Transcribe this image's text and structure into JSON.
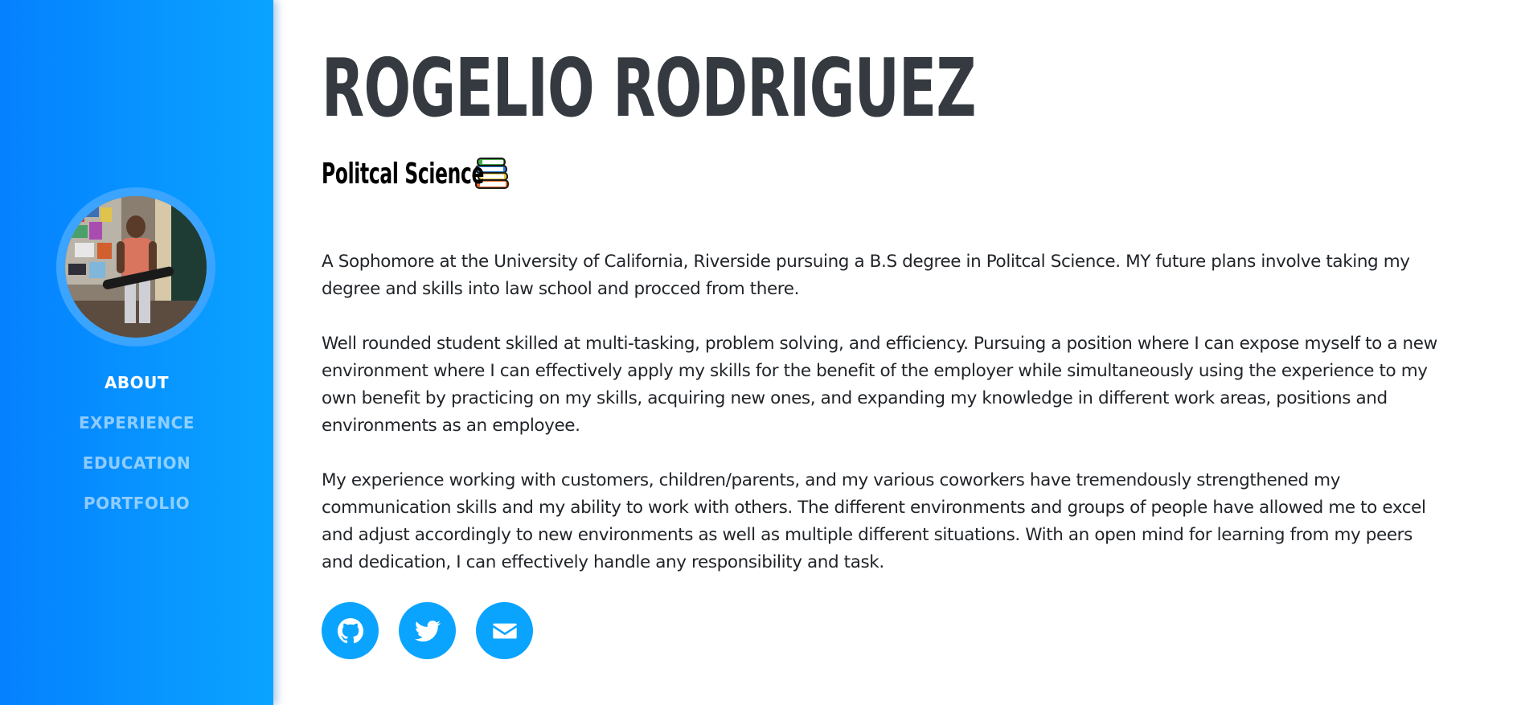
{
  "profile": {
    "name": "ROGELIO RODRIGUEZ",
    "subtitle": "Politcal Science"
  },
  "nav": {
    "items": [
      {
        "label": "ABOUT",
        "active": true
      },
      {
        "label": "EXPERIENCE",
        "active": false
      },
      {
        "label": "EDUCATION",
        "active": false
      },
      {
        "label": "PORTFOLIO",
        "active": false
      }
    ]
  },
  "about": {
    "paragraphs": [
      "A Sophomore at the University of California, Riverside pursuing a B.S degree in Politcal Science. MY future plans involve taking my degree and skills into law school and procced from there.",
      "Well rounded student skilled at multi-tasking, problem solving, and efficiency. Pursuing a position where I can expose myself to a new environment where I can effectively apply my skills for the benefit of the employer while simultaneously using the experience to my own benefit by practicing on my skills, acquiring new ones, and expanding my knowledge in different work areas, positions and environments as an employee.",
      "My experience working with customers, children/parents, and my various coworkers have tremendously strengthened my communication skills and my ability to work with others. The different environments and groups of people have allowed me to excel and adjust accordingly to new environments as well as multiple different situations. With an open mind for learning from my peers and dedication, I can effectively handle any responsibility and task."
    ]
  },
  "socials": [
    {
      "icon": "github-icon"
    },
    {
      "icon": "twitter-icon"
    },
    {
      "icon": "envelope-icon"
    }
  ],
  "colors": {
    "sidebar_start": "#0580ff",
    "sidebar_end": "#0aa4ff",
    "social_bg": "#0aa4ff",
    "heading": "#343a40",
    "body_text": "#212529"
  }
}
